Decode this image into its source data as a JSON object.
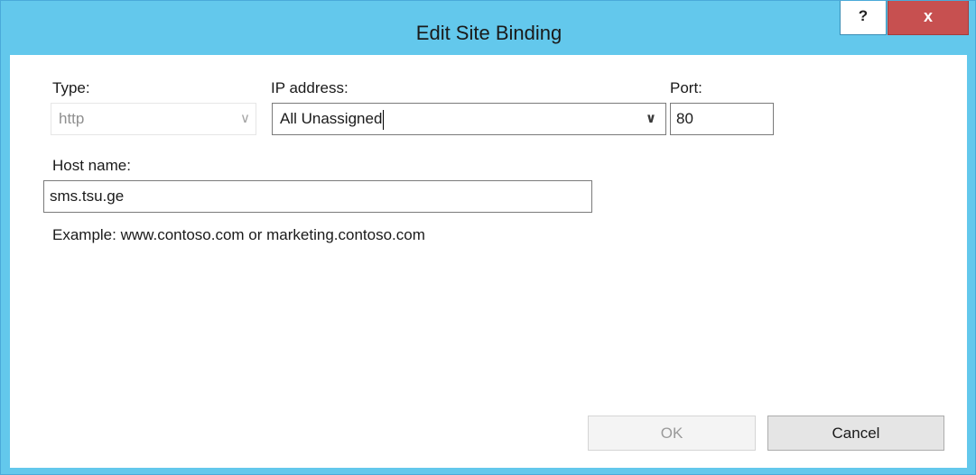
{
  "window": {
    "title": "Edit Site Binding",
    "help_glyph": "?",
    "close_glyph": "x"
  },
  "form": {
    "type_label": "Type:",
    "type_value": "http",
    "ip_label": "IP address:",
    "ip_value": "All Unassigned",
    "port_label": "Port:",
    "port_value": "80",
    "host_label": "Host name:",
    "host_value": "sms.tsu.ge",
    "example_text": "Example: www.contoso.com or marketing.contoso.com"
  },
  "buttons": {
    "ok_label": "OK",
    "cancel_label": "Cancel"
  },
  "icons": {
    "dropdown": "chevron-down-icon"
  },
  "colors": {
    "titlebar": "#63c8ec",
    "close_button": "#c75050",
    "background": "#ffffff"
  }
}
